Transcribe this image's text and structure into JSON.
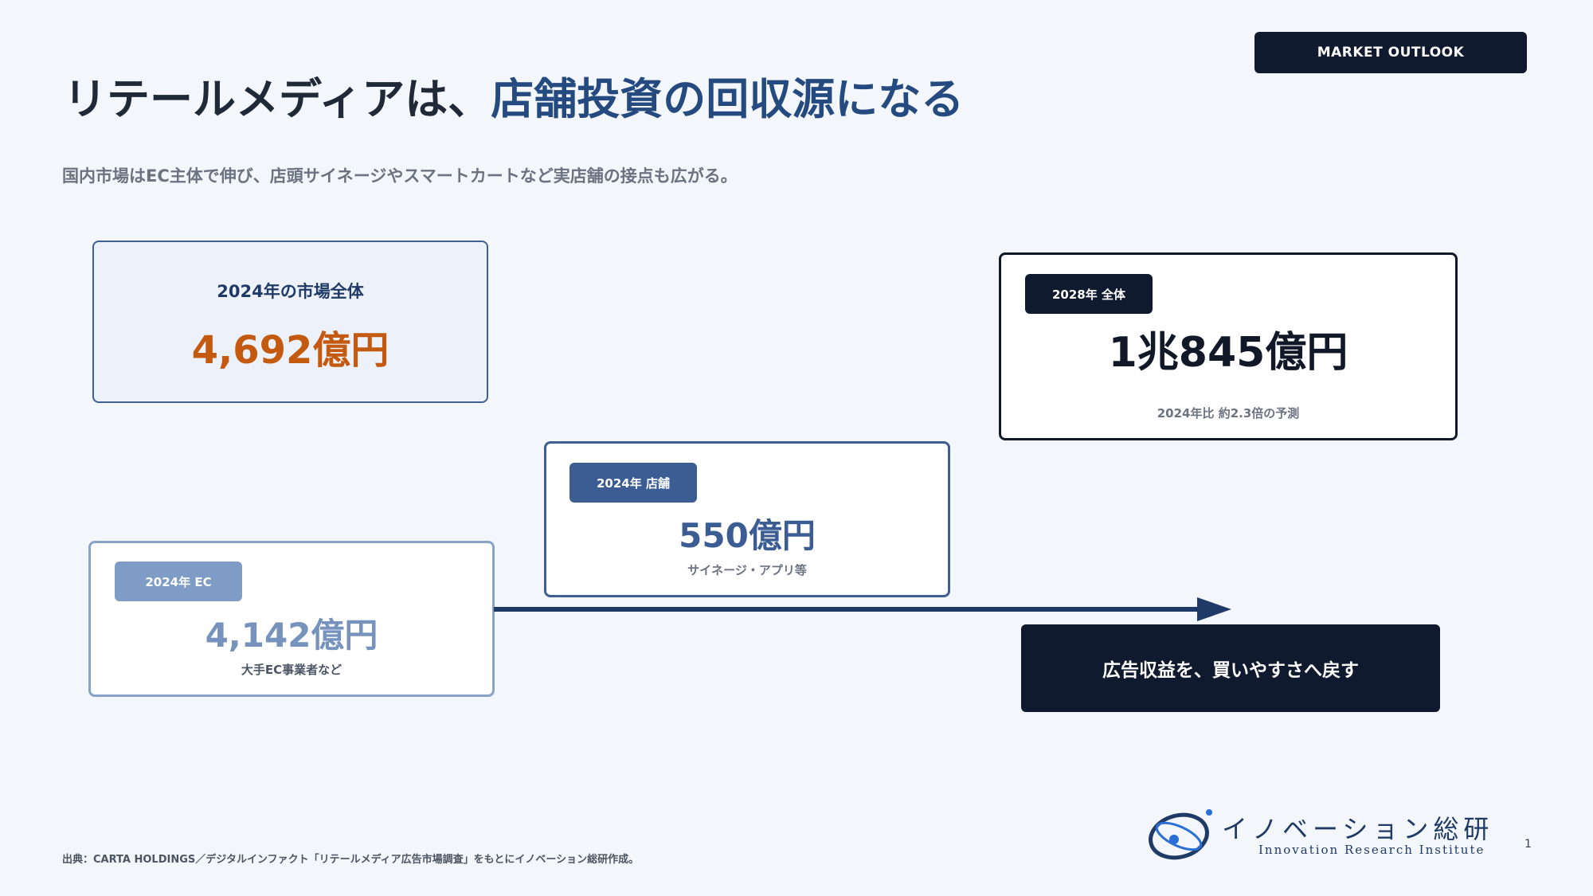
{
  "header": {
    "badge": "MARKET OUTLOOK",
    "title_plain": "リテールメディアは、",
    "title_accent": "店舗投資の回収源になる",
    "subtitle": "国内市場はEC主体で伸び、店頭サイネージやスマートカートなど実店舗の接点も広がる。"
  },
  "cards": {
    "total_2024": {
      "label": "2024年の市場全体",
      "value": "4,692億円"
    },
    "total_2028": {
      "pill": "2028年 全体",
      "value": "1兆845億円",
      "note": "2024年比 約2.3倍の予測"
    },
    "store_2024": {
      "pill": "2024年 店舗",
      "value": "550億円",
      "note": "サイネージ・アプリ等"
    },
    "ec_2024": {
      "pill": "2024年 EC",
      "value": "4,142億円",
      "note": "大手EC事業者など"
    }
  },
  "callout": "広告収益を、買いやすさへ戻す",
  "footer": {
    "source": "出典：CARTA HOLDINGS／デジタルインファクト「リテールメディア広告市場調査」をもとにイノベーション総研作成。",
    "logo_jp": "イノベーション総研",
    "logo_en": "Innovation Research Institute",
    "page_number": "1"
  },
  "colors": {
    "navy": "#0f1a2e",
    "accent_blue": "#244a80",
    "orange": "#c45a0f",
    "mid_blue": "#3b5d94",
    "light_blue": "#7f9cc6"
  }
}
